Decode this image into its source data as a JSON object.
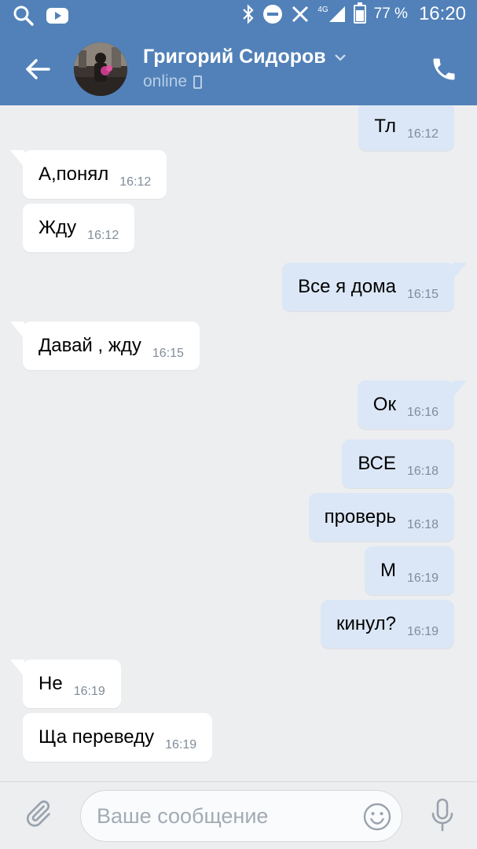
{
  "status_bar": {
    "battery_pct": "77 %",
    "time": "16:20",
    "network": "4G"
  },
  "header": {
    "contact_name": "Григорий Сидоров",
    "presence": "online"
  },
  "messages": [
    {
      "dir": "out",
      "text": "Тл",
      "time": "16:12"
    },
    {
      "dir": "in",
      "text": "А,понял",
      "time": "16:12"
    },
    {
      "dir": "in",
      "text": "Жду",
      "time": "16:12"
    },
    {
      "dir": "out",
      "text": "Все я дома",
      "time": "16:15"
    },
    {
      "dir": "in",
      "text": "Давай , жду",
      "time": "16:15"
    },
    {
      "dir": "out",
      "text": "Ок",
      "time": "16:16"
    },
    {
      "dir": "out",
      "text": "ВСЕ",
      "time": "16:18"
    },
    {
      "dir": "out",
      "text": "проверь",
      "time": "16:18"
    },
    {
      "dir": "out",
      "text": "М",
      "time": "16:19"
    },
    {
      "dir": "out",
      "text": "кинул?",
      "time": "16:19"
    },
    {
      "dir": "in",
      "text": "Не",
      "time": "16:19"
    },
    {
      "dir": "in",
      "text": "Ща переведу",
      "time": "16:19"
    }
  ],
  "composer": {
    "placeholder": "Ваше сообщение"
  },
  "colors": {
    "header_bg": "#5181b8",
    "incoming_bubble": "#ffffff",
    "outgoing_bubble": "#dbe7f6",
    "chat_bg": "#edeef0"
  }
}
